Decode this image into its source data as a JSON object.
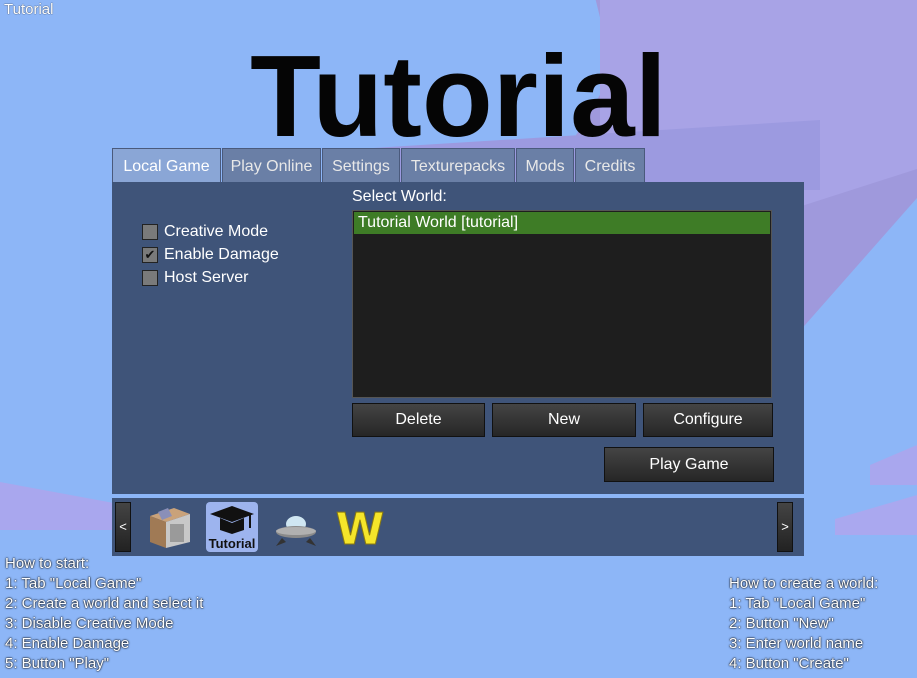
{
  "window_title": "Tutorial",
  "game_title": "Tutorial",
  "tabs": [
    {
      "label": "Local Game",
      "active": true
    },
    {
      "label": "Play Online"
    },
    {
      "label": "Settings"
    },
    {
      "label": "Texturepacks"
    },
    {
      "label": "Mods"
    },
    {
      "label": "Credits"
    }
  ],
  "options": {
    "creative_mode": {
      "label": "Creative Mode",
      "checked": false
    },
    "enable_damage": {
      "label": "Enable Damage",
      "checked": true
    },
    "host_server": {
      "label": "Host Server",
      "checked": false
    }
  },
  "check_mark": "✔",
  "world_select": {
    "label": "Select World:",
    "selected": "Tutorial World [tutorial]",
    "selected_color": "#3e7c26"
  },
  "buttons": {
    "delete": "Delete",
    "new": "New",
    "configure": "Configure",
    "play": "Play Game"
  },
  "game_bar": {
    "prev": "<",
    "next": ">",
    "games": [
      {
        "icon": "box-icon"
      },
      {
        "icon": "graduation-cap-icon",
        "label": "Tutorial",
        "selected": true
      },
      {
        "icon": "ufo-icon"
      },
      {
        "icon": "letter-w-icon",
        "label": "W"
      }
    ]
  },
  "help_left": {
    "title": "How to start:",
    "steps": [
      "1: Tab \"Local Game\"",
      "2: Create a world and select it",
      "3: Disable Creative Mode",
      "4: Enable Damage",
      "5: Button \"Play\""
    ]
  },
  "help_right": {
    "title": "How to create a world:",
    "steps": [
      "1: Tab \"Local Game\"",
      "2: Button \"New\"",
      "3: Enter world name",
      "4: Button \"Create\""
    ]
  },
  "colors": {
    "sky": "#8db6f7",
    "panel": "#3f5479",
    "tab_active": "#8aa6d6"
  }
}
